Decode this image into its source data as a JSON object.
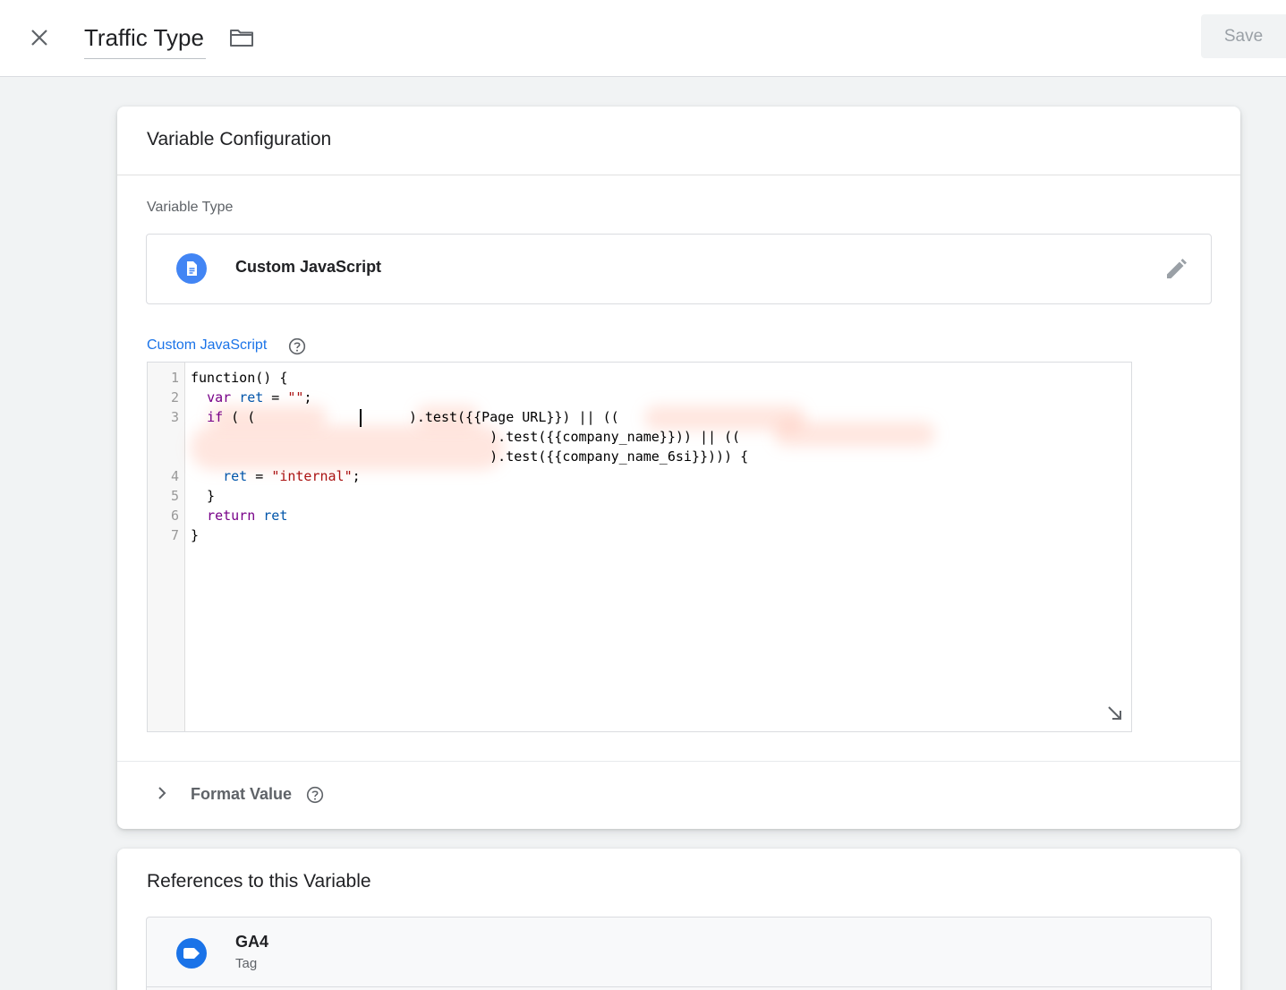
{
  "header": {
    "title": "Traffic Type",
    "save_label": "Save"
  },
  "config": {
    "title": "Variable Configuration",
    "variable_type_label": "Variable Type",
    "variable_type_name": "Custom JavaScript",
    "code_label": "Custom JavaScript",
    "code_lines": [
      {
        "number": "1",
        "segments": [
          [
            "plain",
            "function() {"
          ]
        ]
      },
      {
        "number": "2",
        "segments": [
          [
            "plain",
            "  "
          ],
          [
            "kw",
            "var"
          ],
          [
            "plain",
            " "
          ],
          [
            "var",
            "ret"
          ],
          [
            "plain",
            " = "
          ],
          [
            "str",
            "\"\""
          ],
          [
            "plain",
            ";"
          ]
        ]
      },
      {
        "number": "3",
        "segments": [
          [
            "plain",
            "  "
          ],
          [
            "kw",
            "if"
          ],
          [
            "plain",
            " ( (            "
          ],
          [
            "plain",
            "       ).test({{Page URL}}) || (("
          ]
        ]
      },
      {
        "number": "",
        "segments": [
          [
            "plain",
            "                                     ).test({{company_name}})) || (("
          ]
        ]
      },
      {
        "number": "",
        "segments": [
          [
            "plain",
            "                                     ).test({{company_name_6si}}))) {"
          ]
        ]
      },
      {
        "number": "4",
        "segments": [
          [
            "plain",
            "    "
          ],
          [
            "var",
            "ret"
          ],
          [
            "plain",
            " = "
          ],
          [
            "str",
            "\"internal\""
          ],
          [
            "plain",
            ";"
          ]
        ]
      },
      {
        "number": "5",
        "segments": [
          [
            "plain",
            "  }"
          ]
        ]
      },
      {
        "number": "6",
        "segments": [
          [
            "plain",
            "  "
          ],
          [
            "kw",
            "return"
          ],
          [
            "plain",
            " "
          ],
          [
            "var",
            "ret"
          ]
        ]
      },
      {
        "number": "7",
        "segments": [
          [
            "plain",
            "}"
          ]
        ]
      }
    ],
    "format_value_label": "Format Value"
  },
  "references": {
    "title": "References to this Variable",
    "items": [
      {
        "name": "GA4",
        "type": "Tag"
      }
    ]
  },
  "colors": {
    "accent_blue": "#1a73e8",
    "variable_icon": "#4285f4",
    "keyword": "#770088",
    "variable": "#0055aa",
    "string": "#aa1111"
  },
  "icons": {
    "close": "close-icon",
    "folder": "folder-icon",
    "variable_type": "document-icon",
    "edit": "pencil-icon",
    "help": "help-circle-icon",
    "resize": "resize-arrow-icon",
    "expand": "chevron-right-icon",
    "tag": "tag-icon"
  }
}
